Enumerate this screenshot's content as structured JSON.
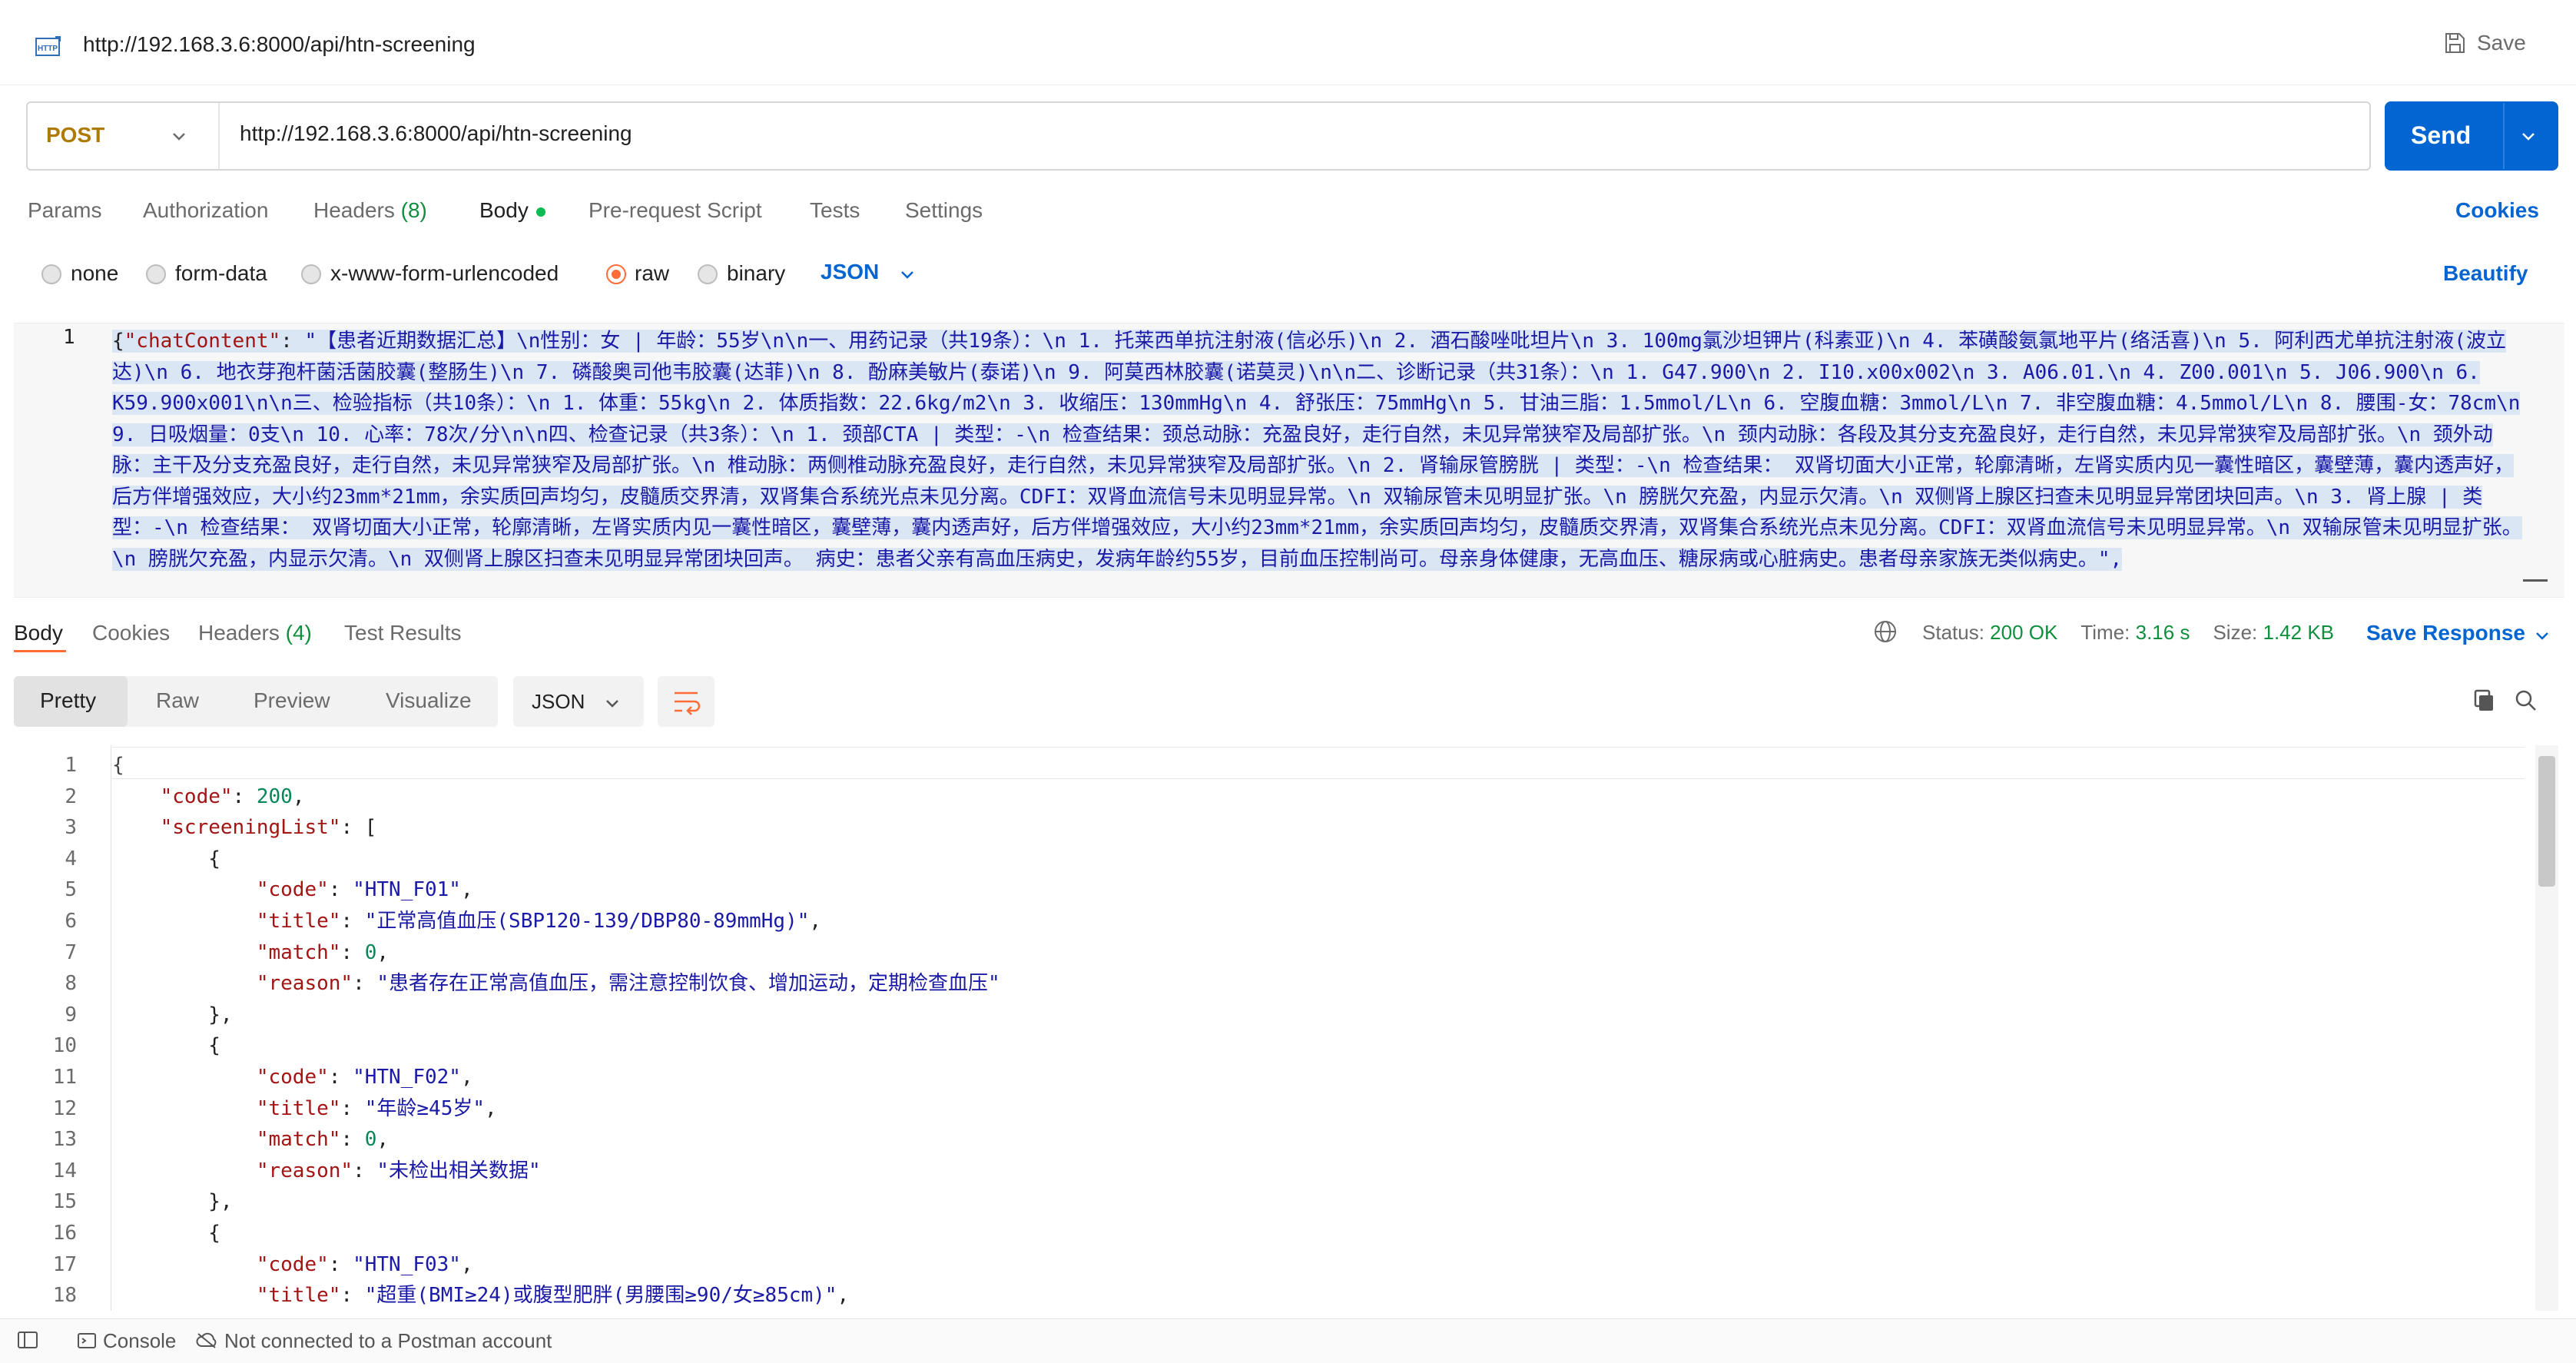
{
  "header": {
    "icon": "http-icon",
    "title": "http://192.168.3.6:8000/api/htn-screening",
    "save_label": "Save"
  },
  "request": {
    "method": "POST",
    "url": "http://192.168.3.6:8000/api/htn-screening",
    "send_label": "Send",
    "tabs": {
      "params": "Params",
      "authorization": "Authorization",
      "headers": "Headers",
      "headers_count": "(8)",
      "body": "Body",
      "prerequest": "Pre-request Script",
      "tests": "Tests",
      "settings": "Settings"
    },
    "cookies_label": "Cookies",
    "body_types": {
      "none": "none",
      "form_data": "form-data",
      "urlencoded": "x-www-form-urlencoded",
      "raw": "raw",
      "binary": "binary"
    },
    "selected_body_type": "raw",
    "format": "JSON",
    "beautify_label": "Beautify",
    "editor": {
      "line_number": "1",
      "brace": "{",
      "key": "\"chatContent\"",
      "colon": ": ",
      "value": "\"【患者近期数据汇总】\\n性别：女 | 年龄：55岁\\n\\n一、用药记录（共19条）：\\n  1. 托莱西单抗注射液(信必乐)\\n  2. 酒石酸唑吡坦片\\n  3. 100mg氯沙坦钾片(科素亚)\\n  4. 苯磺酸氨氯地平片(络活喜)\\n  5. 阿利西尤单抗注射液(波立达)\\n  6. 地衣芽孢杆菌活菌胶囊(整肠生)\\n  7. 磷酸奥司他韦胶囊(达菲)\\n  8. 酚麻美敏片(泰诺)\\n  9. 阿莫西林胶囊(诺莫灵)\\n\\n二、诊断记录（共31条）：\\n  1. G47.900\\n  2. I10.x00x002\\n  3. A06.01.\\n  4. Z00.001\\n  5. J06.900\\n  6. K59.900x001\\n\\n三、检验指标（共10条）：\\n  1. 体重：55kg\\n  2. 体质指数：22.6kg/m2\\n  3. 收缩压：130mmHg\\n  4. 舒张压：75mmHg\\n  5. 甘油三脂：1.5mmol/L\\n  6. 空腹血糖：3mmol/L\\n  7. 非空腹血糖：4.5mmol/L\\n  8. 腰围-女：78cm\\n  9. 日吸烟量：0支\\n  10. 心率：78次/分\\n\\n四、检查记录（共3条）：\\n  1. 颈部CTA | 类型：-\\n    检查结果：颈总动脉：充盈良好，走行自然，未见异常狭窄及局部扩张。\\n    颈内动脉：各段及其分支充盈良好，走行自然，未见异常狭窄及局部扩张。\\n    颈外动脉：主干及分支充盈良好，走行自然，未见异常狭窄及局部扩张。\\n    椎动脉：两侧椎动脉充盈良好，走行自然，未见异常狭窄及局部扩张。\\n  2. 肾输尿管膀胱 | 类型：-\\n    检查结果：    双肾切面大小正常，轮廓清晰，左肾实质内见一囊性暗区，囊壁薄，囊内透声好，后方伴增强效应，大小约23mm*21mm，余实质回声均匀，皮髓质交界清，双肾集合系统光点未见分离。CDFI：双肾血流信号未见明显异常。\\n       双输尿管未见明显扩张。\\n       膀胱欠充盈，内显示欠清。\\n       双侧肾上腺区扫查未见明显异常团块回声。\\n  3. 肾上腺 | 类型：-\\n    检查结果：    双肾切面大小正常，轮廓清晰，左肾实质内见一囊性暗区，囊壁薄，囊内透声好，后方伴增强效应，大小约23mm*21mm，余实质回声均匀，皮髓质交界清，双肾集合系统光点未见分离。CDFI：双肾血流信号未见明显异常。\\n       双输尿管未见明显扩张。\\n       膀胱欠充盈，内显示欠清。\\n       双侧肾上腺区扫查未见明显异常团块回声。  病史：患者父亲有高血压病史，发病年龄约55岁，目前血压控制尚可。母亲身体健康，无高血压、糖尿病或心脏病史。患者母亲家族无类似病史。\","
    }
  },
  "response": {
    "tabs": {
      "body": "Body",
      "cookies": "Cookies",
      "headers": "Headers",
      "headers_count": "(4)",
      "test_results": "Test Results"
    },
    "status_label": "Status:",
    "status_value": "200 OK",
    "time_label": "Time:",
    "time_value": "3.16 s",
    "size_label": "Size:",
    "size_value": "1.42 KB",
    "save_response_label": "Save Response",
    "view_modes": {
      "pretty": "Pretty",
      "raw": "Raw",
      "preview": "Preview",
      "visualize": "Visualize"
    },
    "format": "JSON",
    "line_numbers": [
      "1",
      "2",
      "3",
      "4",
      "5",
      "6",
      "7",
      "8",
      "9",
      "10",
      "11",
      "12",
      "13",
      "14",
      "15",
      "16",
      "17",
      "18"
    ],
    "code": {
      "open": "{",
      "code_key": "\"code\"",
      "code_val": "200",
      "list_key": "\"screeningList\"",
      "list_open": "[",
      "items": [
        {
          "code": "\"HTN_F01\"",
          "title": "\"正常高值血压(SBP120-139/DBP80-89mmHg)\"",
          "match": "0",
          "reason": "\"患者存在正常高值血压，需注意控制饮食、增加运动，定期检查血压\""
        },
        {
          "code": "\"HTN_F02\"",
          "title": "\"年龄≥45岁\"",
          "match": "0",
          "reason": "\"未检出相关数据\""
        },
        {
          "code": "\"HTN_F03\"",
          "title": "\"超重(BMI≥24)或腹型肥胖(男腰围≥90/女≥85cm)\""
        }
      ],
      "k_code": "\"code\"",
      "k_title": "\"title\"",
      "k_match": "\"match\"",
      "k_reason": "\"reason\""
    }
  },
  "statusbar": {
    "console": "Console",
    "account": "Not connected to a Postman account"
  },
  "colors": {
    "accent": "#ff6c37",
    "send": "#0265d2",
    "method": "#ad7a03",
    "ok": "#0f8f3e"
  }
}
